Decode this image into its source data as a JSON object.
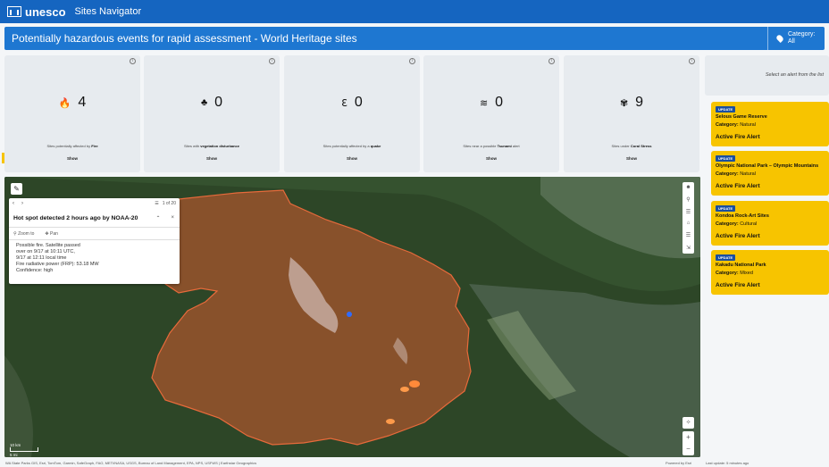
{
  "header": {
    "logo_text": "unesco",
    "app_title": "Sites Navigator"
  },
  "banner": {
    "title": "Potentially hazardous events for rapid assessment - World Heritage sites",
    "category_label": "Category:",
    "category_value": "All"
  },
  "stats": [
    {
      "icon": "flame-icon",
      "glyph": "🔥",
      "value": "4",
      "desc_prefix": "Sites potentially affected by",
      "desc_bold": "Fire",
      "desc_suffix": "",
      "show": "Show"
    },
    {
      "icon": "vegetation-icon",
      "glyph": "♣",
      "value": "0",
      "desc_prefix": "Sites with",
      "desc_bold": "vegetation disturbance",
      "desc_suffix": "",
      "show": "Show"
    },
    {
      "icon": "seismic-icon",
      "glyph": "⌇",
      "value": "0",
      "desc_prefix": "Sites potentially affected by a",
      "desc_bold": "quake",
      "desc_suffix": "",
      "show": "Show"
    },
    {
      "icon": "tsunami-icon",
      "glyph": "≋",
      "value": "0",
      "desc_prefix": "Sites near a possible",
      "desc_bold": "Tsunami",
      "desc_suffix": "alert",
      "show": "Show"
    },
    {
      "icon": "coral-icon",
      "glyph": "✾",
      "value": "9",
      "desc_prefix": "Sites under",
      "desc_bold": "Coral Stress",
      "desc_suffix": "",
      "show": "Show"
    }
  ],
  "right_panel": {
    "hint": "Select an alert from the list"
  },
  "alerts": [
    {
      "badge": "UPDATE",
      "name": "Selous Game Reserve",
      "category_label": "Category:",
      "category": "Natural",
      "status": "Active Fire Alert"
    },
    {
      "badge": "UPDATE",
      "name": "Olympic National Park – Olympic Mountains",
      "category_label": "Category:",
      "category": "Natural",
      "status": "Active Fire Alert"
    },
    {
      "badge": "UPDATE",
      "name": "Kondoa Rock-Art Sites",
      "category_label": "Category:",
      "category": "Cultural",
      "status": "Active Fire Alert"
    },
    {
      "badge": "UPDATE",
      "name": "Kakadu National Park",
      "category_label": "Category:",
      "category": "Mixed",
      "status": "Active Fire Alert"
    }
  ],
  "popup": {
    "pages": "1 of 20",
    "title": "Hot spot detected 2 hours ago by NOAA-20",
    "zoom_to": "Zoom to",
    "pan": "Pan",
    "body": [
      "Possible fire. Satellite passed",
      "over on 9/17 at 10:11 UTC,",
      "9/17 at 12:11 local time",
      "Fire radiative power (FRP): 53.18 MW",
      "Confidence: high"
    ]
  },
  "map": {
    "scale_km": "10 km",
    "scale_mi": "5 mi"
  },
  "footer": {
    "attribution": "WA State Parks GIS, Esri, TomTom, Garmin, SafeGraph, FAO, METI/NASA, USGS, Bureau of Land Management, EPA, NPS, USFWS | Earthstar Geographics",
    "powered_by": "Powered by Esri",
    "last_update": "Last update: 5 minutes ago"
  },
  "colors": {
    "header": "#1565c0",
    "banner": "#1e77d1",
    "alert_card": "#f7c400",
    "badge": "#1a4fa0",
    "fire_area": "#c0582f"
  }
}
